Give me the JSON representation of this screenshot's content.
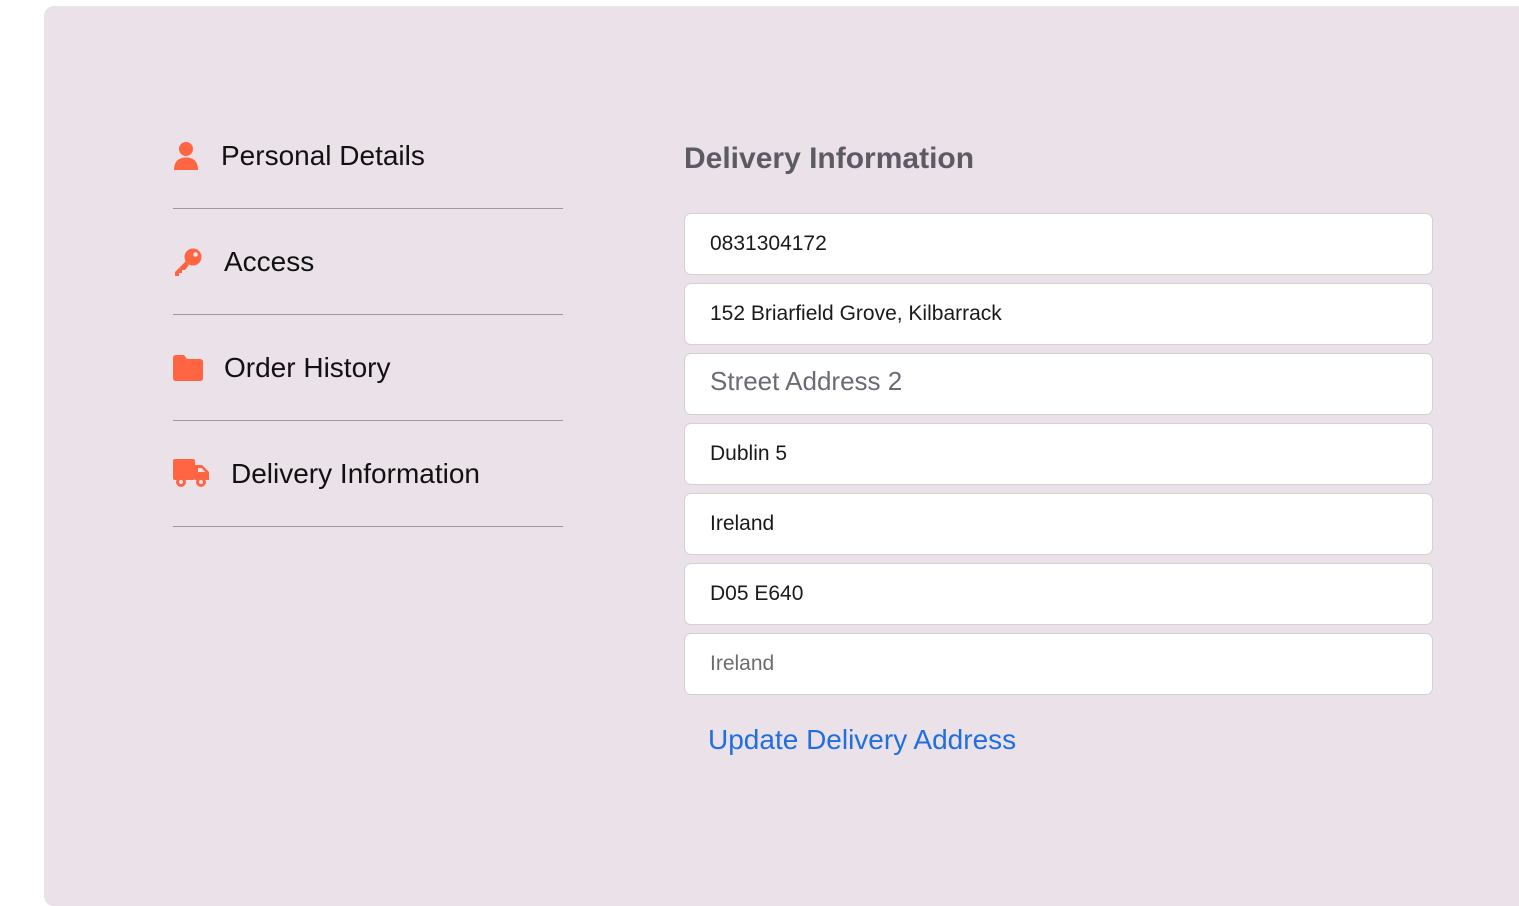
{
  "sidebar": {
    "items": [
      {
        "label": "Personal Details",
        "icon": "user-icon"
      },
      {
        "label": "Access",
        "icon": "key-icon"
      },
      {
        "label": "Order History",
        "icon": "folder-icon"
      },
      {
        "label": "Delivery Information",
        "icon": "truck-icon"
      }
    ]
  },
  "main": {
    "title": "Delivery Information",
    "fields": {
      "phone": {
        "value": "0831304172"
      },
      "street1": {
        "value": "152 Briarfield Grove, Kilbarrack"
      },
      "street2": {
        "value": "",
        "placeholder": "Street Address 2"
      },
      "city": {
        "value": "Dublin 5"
      },
      "county": {
        "value": "Ireland"
      },
      "postcode": {
        "value": "D05 E640"
      },
      "country": {
        "value": "Ireland"
      }
    },
    "update_label": "Update Delivery Address"
  },
  "colors": {
    "accent": "#ff6542",
    "panel_bg": "#ebe1e9",
    "link": "#1f6fe0"
  }
}
